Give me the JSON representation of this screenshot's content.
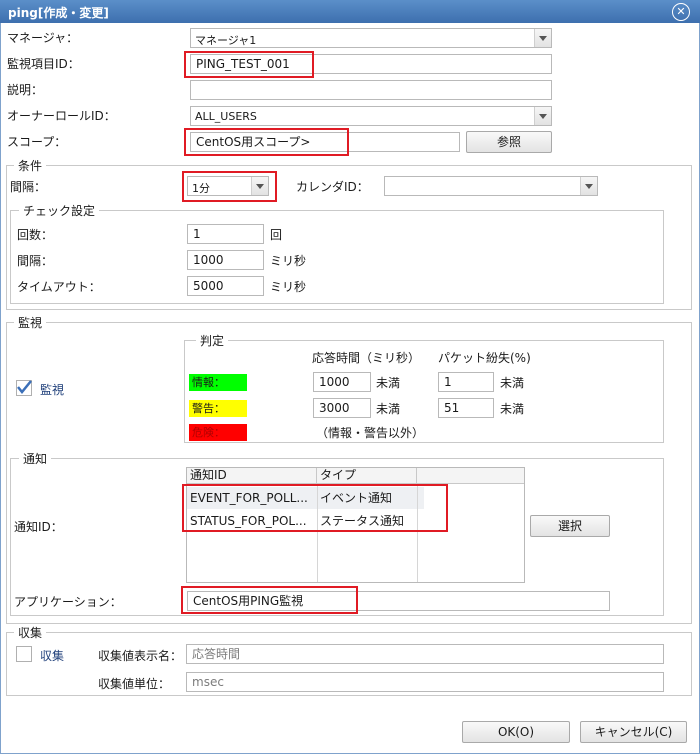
{
  "window": {
    "title": "ping[作成・変更]"
  },
  "fields": {
    "manager": {
      "label": "マネージャ：",
      "value": "マネージャ1"
    },
    "monitor_id": {
      "label": "監視項目ID：",
      "value": "PING_TEST_001"
    },
    "description": {
      "label": "説明：",
      "value": ""
    },
    "owner_role": {
      "label": "オーナーロールID：",
      "value": "ALL_USERS"
    },
    "scope": {
      "label": "スコープ：",
      "value": "CentOS用スコープ>",
      "button": "参照"
    }
  },
  "condition": {
    "legend": "条件",
    "interval": {
      "label": "間隔：",
      "value": "1分"
    },
    "calendar": {
      "label": "カレンダID：",
      "value": ""
    },
    "check": {
      "legend": "チェック設定",
      "count": {
        "label": "回数：",
        "value": "1",
        "unit": "回"
      },
      "interval": {
        "label": "間隔：",
        "value": "1000",
        "unit": "ミリ秒"
      },
      "timeout": {
        "label": "タイムアウト：",
        "value": "5000",
        "unit": "ミリ秒"
      }
    }
  },
  "monitor": {
    "legend": "監視",
    "checkbox_label": "監視",
    "checked": true,
    "judge": {
      "legend": "判定",
      "col_response": "応答時間（ミリ秒）",
      "col_packet": "パケット紛失(%)",
      "info": {
        "label": "情報：",
        "color": "#00ff00",
        "response": "1000",
        "response_unit": "未満",
        "packet": "1",
        "packet_unit": "未満"
      },
      "warn": {
        "label": "警告：",
        "color": "#ffff00",
        "response": "3000",
        "response_unit": "未満",
        "packet": "51",
        "packet_unit": "未満"
      },
      "danger": {
        "label": "危険：",
        "color": "#ff0000",
        "note": "（情報・警告以外）"
      }
    }
  },
  "notify": {
    "legend": "通知",
    "label": "通知ID：",
    "columns": [
      "通知ID",
      "タイプ"
    ],
    "rows": [
      {
        "id": "EVENT_FOR_POLL...",
        "type": "イベント通知"
      },
      {
        "id": "STATUS_FOR_POL...",
        "type": "ステータス通知"
      }
    ],
    "select_button": "選択",
    "application": {
      "label": "アプリケーション：",
      "value": "CentOS用PING監視"
    }
  },
  "collect": {
    "legend": "収集",
    "checkbox_label": "収集",
    "checked": false,
    "display_name": {
      "label": "収集値表示名：",
      "value": "応答時間"
    },
    "unit": {
      "label": "収集値単位：",
      "value": "msec"
    }
  },
  "footer": {
    "ok": "OK(O)",
    "cancel": "キャンセル(C)"
  }
}
